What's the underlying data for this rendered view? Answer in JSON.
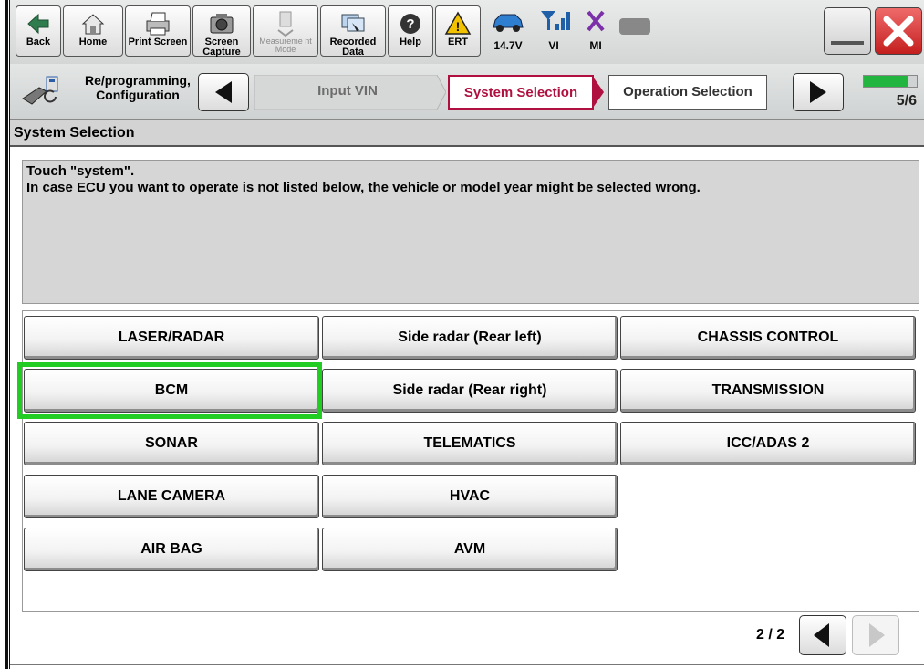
{
  "toolbar": {
    "back": "Back",
    "home": "Home",
    "print_screen": "Print Screen",
    "screen_capture": "Screen Capture",
    "measurement_mode": "Measureme nt Mode",
    "recorded_data": "Recorded Data",
    "help": "Help",
    "ert": "ERT",
    "voltage": "14.7V",
    "vi": "VI",
    "mi": "MI"
  },
  "nav": {
    "tool_label_line1": "Re/programming,",
    "tool_label_line2": "Configuration",
    "steps": [
      "Input VIN",
      "System Selection",
      "Operation Selection"
    ],
    "page_indicator": "5/6",
    "progress": 0.83
  },
  "page_title": "System Selection",
  "instructions": {
    "line1": "Touch \"system\".",
    "line2": "In case ECU you want to operate is not listed below, the vehicle or model year might be selected wrong."
  },
  "systems": {
    "col1": [
      "LASER/RADAR",
      "BCM",
      "SONAR",
      "LANE CAMERA",
      "AIR BAG"
    ],
    "col2": [
      "Side radar (Rear left)",
      "Side radar (Rear right)",
      "TELEMATICS",
      "HVAC",
      "AVM"
    ],
    "col3": [
      "CHASSIS CONTROL",
      "TRANSMISSION",
      "ICC/ADAS 2"
    ]
  },
  "pager": {
    "text": "2 / 2"
  },
  "colors": {
    "current_step": "#b01040",
    "highlight": "#22cc22",
    "progress": "#22b540"
  }
}
